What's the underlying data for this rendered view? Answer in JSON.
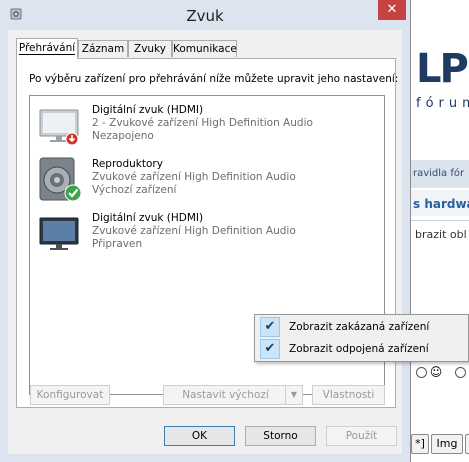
{
  "window": {
    "title": "Zvuk",
    "close_label": "✕",
    "menu_icon": "speaker-system-icon"
  },
  "tabs": [
    {
      "label": "Přehrávání",
      "active": true
    },
    {
      "label": "Záznam",
      "active": false
    },
    {
      "label": "Zvuky",
      "active": false
    },
    {
      "label": "Komunikace",
      "active": false
    }
  ],
  "playback": {
    "instruction": "Po výběru zařízení pro přehrávání níže můžete upravit jeho nastavení:",
    "devices": [
      {
        "name": "Digitální zvuk (HDMI)",
        "description": "2 - Zvukové zařízení High Definition Audio",
        "status": "Nezapojeno",
        "icon": "monitor-icon",
        "badge": "unplugged-badge-icon"
      },
      {
        "name": "Reproduktory",
        "description": "Zvukové zařízení High Definition Audio",
        "status": "Výchozí zařízení",
        "icon": "speaker-icon",
        "badge": "default-check-badge-icon"
      },
      {
        "name": "Digitální zvuk (HDMI)",
        "description": "Zvukové zařízení High Definition Audio",
        "status": "Připraven",
        "icon": "monitor-icon",
        "badge": ""
      }
    ],
    "buttons": {
      "configure": "Konfigurovat",
      "set_default": "Nastavit výchozí",
      "properties": "Vlastnosti"
    }
  },
  "dialog_buttons": {
    "ok": "OK",
    "cancel": "Storno",
    "apply": "Použít"
  },
  "context_menu": [
    {
      "label": "Zobrazit zakázaná zařízení",
      "checked": true
    },
    {
      "label": "Zobrazit odpojená zařízení",
      "checked": true
    }
  ],
  "background_page": {
    "logo_letters": "LP",
    "logo_sub": "fórum",
    "strip_text": "ravidla fór",
    "link_text": "s hardwa",
    "body_text": "brazit obl",
    "bottom_buttons": [
      "*]",
      "Img"
    ]
  },
  "colors": {
    "close_button": "#c74343",
    "window_frame": "#dbe4ef",
    "menu_check_bg": "#cce4f7",
    "default_badge": "#3fa34d",
    "unplugged_badge": "#d0342c"
  }
}
